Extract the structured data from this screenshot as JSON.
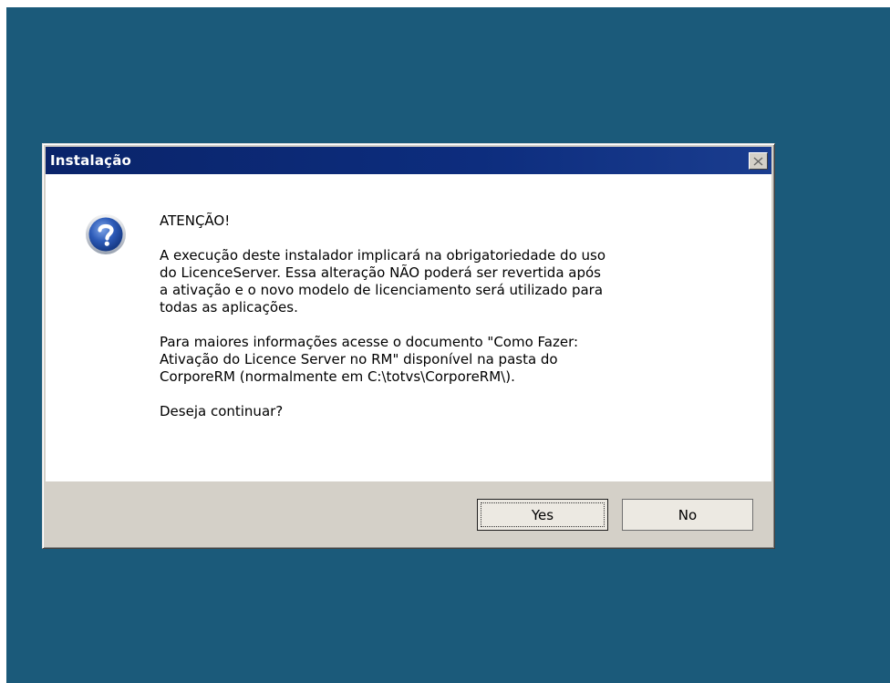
{
  "dialog": {
    "title": "Instalação",
    "close_icon": "close-icon",
    "message_icon": "question-icon",
    "heading": "ATENÇÃO!",
    "paragraph1": "A execução deste instalador implicará na obrigatoriedade do uso\ndo LicenceServer. Essa alteração NÃO poderá ser revertida após\na ativação e o novo modelo de licenciamento será utilizado para\ntodas as aplicações.",
    "paragraph2": "Para maiores informações acesse o documento \"Como Fazer:\nAtivação do Licence Server no RM\" disponível na pasta do\nCorporeRM (normalmente em C:\\totvs\\CorporeRM\\).",
    "question": "Deseja continuar?",
    "buttons": {
      "yes": "Yes",
      "no": "No"
    }
  },
  "colors": {
    "desktop": "#1b5a7a",
    "titlebar": "#0a246a",
    "dialog_face": "#d4d0c8",
    "question_icon": "#2d5bb8"
  }
}
